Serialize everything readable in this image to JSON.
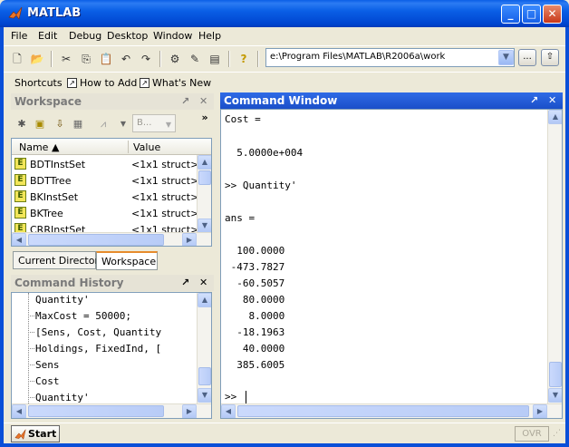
{
  "window": {
    "title": "MATLAB",
    "controls": {
      "minimize": "_",
      "maximize": "□",
      "close": "✕"
    }
  },
  "menu": [
    "File",
    "Edit",
    "Debug",
    "Desktop",
    "Window",
    "Help"
  ],
  "toolbar": {
    "current_directory": "e:\\Program Files\\MATLAB\\R2006a\\work",
    "browse_label": "...",
    "up_folder_icon": "folder-up-icon"
  },
  "shortcuts": {
    "label": "Shortcuts",
    "items": [
      "How to Add",
      "What's New"
    ]
  },
  "workspace": {
    "title": "Workspace",
    "dock_glyph": "↗",
    "close_glyph": "✕",
    "more_glyph": "»",
    "dropdown_value": "B...",
    "columns": {
      "name": "Name ▲",
      "value": "Value"
    },
    "rows": [
      {
        "name": "BDTInstSet",
        "value": "<1x1 struct>"
      },
      {
        "name": "BDTTree",
        "value": "<1x1 struct>"
      },
      {
        "name": "BKInstSet",
        "value": "<1x1 struct>"
      },
      {
        "name": "BKTree",
        "value": "<1x1 struct>"
      },
      {
        "name": "CRRInstSet",
        "value": "<1x1 struct>"
      }
    ],
    "tabs": [
      "Current Directory",
      "Workspace"
    ],
    "selected_tab": "Workspace"
  },
  "command_history": {
    "title": "Command History",
    "dock_glyph": "↗",
    "close_glyph": "✕",
    "lines": [
      "Quantity'",
      "MaxCost = 50000;",
      "[Sens, Cost, Quantity",
      "Holdings, FixedInd, [",
      "Sens",
      "Cost",
      "Quantity'"
    ]
  },
  "command_window": {
    "title": "Command Window",
    "dock_glyph": "↗",
    "close_glyph": "✕",
    "lines": [
      "Cost =",
      "",
      "  5.0000e+004",
      "",
      ">> Quantity'",
      "",
      "ans =",
      "",
      "  100.0000",
      " -473.7827",
      "  -60.5057",
      "   80.0000",
      "    8.0000",
      "  -18.1963",
      "   40.0000",
      "  385.6005",
      "",
      ">> "
    ]
  },
  "status": {
    "start_label": "Start",
    "ovr_label": "OVR"
  },
  "colors": {
    "titlebar": "#0A5FE6",
    "pane_active": "#1A4FC9",
    "window_bg": "#ECE9D8"
  }
}
